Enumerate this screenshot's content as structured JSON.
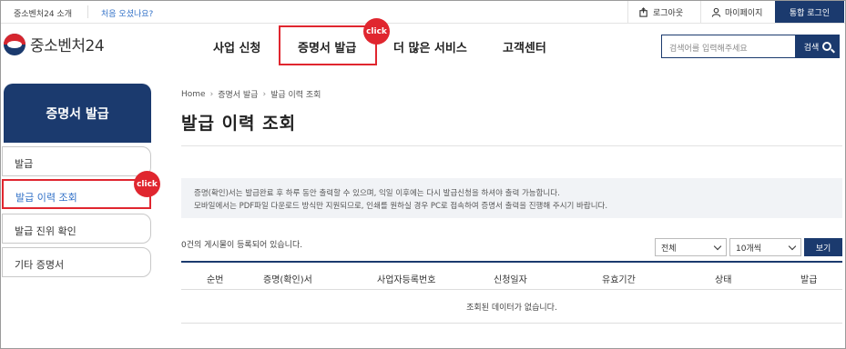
{
  "util": {
    "intro": "중소벤처24 소개",
    "first_visit": "처음 오셨나요?",
    "logout": "로그아웃",
    "mypage": "마이페이지",
    "login": "통합 로그인"
  },
  "header": {
    "logo": "중소벤처24",
    "nav": [
      "사업 신청",
      "증명서 발급",
      "더 많은 서비스",
      "고객센터"
    ],
    "search_placeholder": "검색어를 입력해주세요",
    "search_button": "검색"
  },
  "click_label": "click",
  "sidebar": {
    "title": "증명서 발급",
    "items": [
      {
        "label": "발급"
      },
      {
        "label": "발급 이력 조회"
      },
      {
        "label": "발급 진위 확인"
      },
      {
        "label": "기타 증명서"
      }
    ]
  },
  "breadcrumb": [
    "Home",
    "증명서 발급",
    "발급 이력 조회"
  ],
  "page_title": "발급 이력 조회",
  "notice": [
    "증명(확인)서는 발급완료 후 하루 동안 출력할 수 있으며, 익일 이후에는 다시 발급신청을 하셔야 출력 가능합니다.",
    "모바일에서는 PDF파일 다운로드 방식만 지원되므로, 인쇄를 원하실 경우 PC로 접속하여 증명서 출력을 진행해 주시기 바랍니다."
  ],
  "list": {
    "count_text": "0건의 게시물이 등록되어 있습니다.",
    "filter_selected": "전체",
    "page_size_selected": "10개씩",
    "view_button": "보기",
    "columns": [
      "순번",
      "증명(확인)서",
      "사업자등록번호",
      "신청일자",
      "유효기간",
      "상태",
      "발급"
    ],
    "empty_text": "조회된 데이터가 없습니다."
  }
}
